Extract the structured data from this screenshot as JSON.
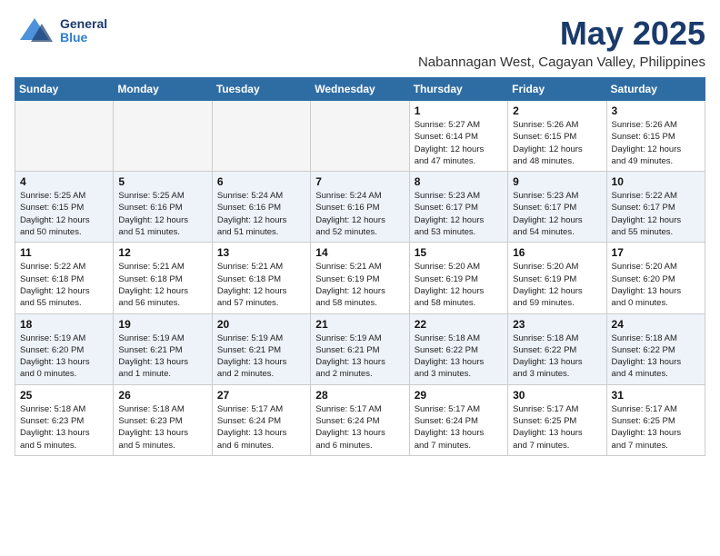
{
  "header": {
    "logo_general": "General",
    "logo_blue": "Blue",
    "month_title": "May 2025",
    "location": "Nabannagan West, Cagayan Valley, Philippines"
  },
  "days_of_week": [
    "Sunday",
    "Monday",
    "Tuesday",
    "Wednesday",
    "Thursday",
    "Friday",
    "Saturday"
  ],
  "weeks": [
    [
      {
        "day": "",
        "info": ""
      },
      {
        "day": "",
        "info": ""
      },
      {
        "day": "",
        "info": ""
      },
      {
        "day": "",
        "info": ""
      },
      {
        "day": "1",
        "info": "Sunrise: 5:27 AM\nSunset: 6:14 PM\nDaylight: 12 hours\nand 47 minutes."
      },
      {
        "day": "2",
        "info": "Sunrise: 5:26 AM\nSunset: 6:15 PM\nDaylight: 12 hours\nand 48 minutes."
      },
      {
        "day": "3",
        "info": "Sunrise: 5:26 AM\nSunset: 6:15 PM\nDaylight: 12 hours\nand 49 minutes."
      }
    ],
    [
      {
        "day": "4",
        "info": "Sunrise: 5:25 AM\nSunset: 6:15 PM\nDaylight: 12 hours\nand 50 minutes."
      },
      {
        "day": "5",
        "info": "Sunrise: 5:25 AM\nSunset: 6:16 PM\nDaylight: 12 hours\nand 51 minutes."
      },
      {
        "day": "6",
        "info": "Sunrise: 5:24 AM\nSunset: 6:16 PM\nDaylight: 12 hours\nand 51 minutes."
      },
      {
        "day": "7",
        "info": "Sunrise: 5:24 AM\nSunset: 6:16 PM\nDaylight: 12 hours\nand 52 minutes."
      },
      {
        "day": "8",
        "info": "Sunrise: 5:23 AM\nSunset: 6:17 PM\nDaylight: 12 hours\nand 53 minutes."
      },
      {
        "day": "9",
        "info": "Sunrise: 5:23 AM\nSunset: 6:17 PM\nDaylight: 12 hours\nand 54 minutes."
      },
      {
        "day": "10",
        "info": "Sunrise: 5:22 AM\nSunset: 6:17 PM\nDaylight: 12 hours\nand 55 minutes."
      }
    ],
    [
      {
        "day": "11",
        "info": "Sunrise: 5:22 AM\nSunset: 6:18 PM\nDaylight: 12 hours\nand 55 minutes."
      },
      {
        "day": "12",
        "info": "Sunrise: 5:21 AM\nSunset: 6:18 PM\nDaylight: 12 hours\nand 56 minutes."
      },
      {
        "day": "13",
        "info": "Sunrise: 5:21 AM\nSunset: 6:18 PM\nDaylight: 12 hours\nand 57 minutes."
      },
      {
        "day": "14",
        "info": "Sunrise: 5:21 AM\nSunset: 6:19 PM\nDaylight: 12 hours\nand 58 minutes."
      },
      {
        "day": "15",
        "info": "Sunrise: 5:20 AM\nSunset: 6:19 PM\nDaylight: 12 hours\nand 58 minutes."
      },
      {
        "day": "16",
        "info": "Sunrise: 5:20 AM\nSunset: 6:19 PM\nDaylight: 12 hours\nand 59 minutes."
      },
      {
        "day": "17",
        "info": "Sunrise: 5:20 AM\nSunset: 6:20 PM\nDaylight: 13 hours\nand 0 minutes."
      }
    ],
    [
      {
        "day": "18",
        "info": "Sunrise: 5:19 AM\nSunset: 6:20 PM\nDaylight: 13 hours\nand 0 minutes."
      },
      {
        "day": "19",
        "info": "Sunrise: 5:19 AM\nSunset: 6:21 PM\nDaylight: 13 hours\nand 1 minute."
      },
      {
        "day": "20",
        "info": "Sunrise: 5:19 AM\nSunset: 6:21 PM\nDaylight: 13 hours\nand 2 minutes."
      },
      {
        "day": "21",
        "info": "Sunrise: 5:19 AM\nSunset: 6:21 PM\nDaylight: 13 hours\nand 2 minutes."
      },
      {
        "day": "22",
        "info": "Sunrise: 5:18 AM\nSunset: 6:22 PM\nDaylight: 13 hours\nand 3 minutes."
      },
      {
        "day": "23",
        "info": "Sunrise: 5:18 AM\nSunset: 6:22 PM\nDaylight: 13 hours\nand 3 minutes."
      },
      {
        "day": "24",
        "info": "Sunrise: 5:18 AM\nSunset: 6:22 PM\nDaylight: 13 hours\nand 4 minutes."
      }
    ],
    [
      {
        "day": "25",
        "info": "Sunrise: 5:18 AM\nSunset: 6:23 PM\nDaylight: 13 hours\nand 5 minutes."
      },
      {
        "day": "26",
        "info": "Sunrise: 5:18 AM\nSunset: 6:23 PM\nDaylight: 13 hours\nand 5 minutes."
      },
      {
        "day": "27",
        "info": "Sunrise: 5:17 AM\nSunset: 6:24 PM\nDaylight: 13 hours\nand 6 minutes."
      },
      {
        "day": "28",
        "info": "Sunrise: 5:17 AM\nSunset: 6:24 PM\nDaylight: 13 hours\nand 6 minutes."
      },
      {
        "day": "29",
        "info": "Sunrise: 5:17 AM\nSunset: 6:24 PM\nDaylight: 13 hours\nand 7 minutes."
      },
      {
        "day": "30",
        "info": "Sunrise: 5:17 AM\nSunset: 6:25 PM\nDaylight: 13 hours\nand 7 minutes."
      },
      {
        "day": "31",
        "info": "Sunrise: 5:17 AM\nSunset: 6:25 PM\nDaylight: 13 hours\nand 7 minutes."
      }
    ]
  ]
}
